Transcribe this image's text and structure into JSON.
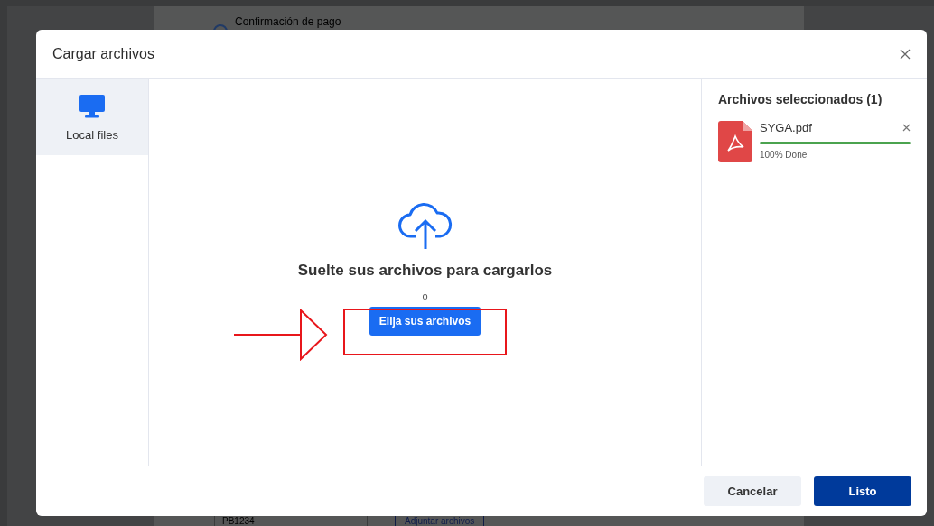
{
  "background": {
    "step_label": "Confirmación de pago",
    "reference": "PB1234",
    "attach_button": "Adjuntar archivos"
  },
  "dialog": {
    "title": "Cargar archivos"
  },
  "sources": [
    {
      "label": "Local files",
      "selected": true
    }
  ],
  "dropzone": {
    "heading": "Suelte sus archivos para cargarlos",
    "separator": "o",
    "button": "Elija sus archivos"
  },
  "selected_panel": {
    "title": "Archivos seleccionados (1)",
    "files": [
      {
        "name": "SYGA.pdf",
        "level": 1,
        "status": "100% Done"
      }
    ]
  },
  "footer": {
    "buttons": [
      {
        "label": "Cancelar",
        "kind": "secondary"
      },
      {
        "label": "Listo",
        "kind": "primary"
      }
    ]
  }
}
